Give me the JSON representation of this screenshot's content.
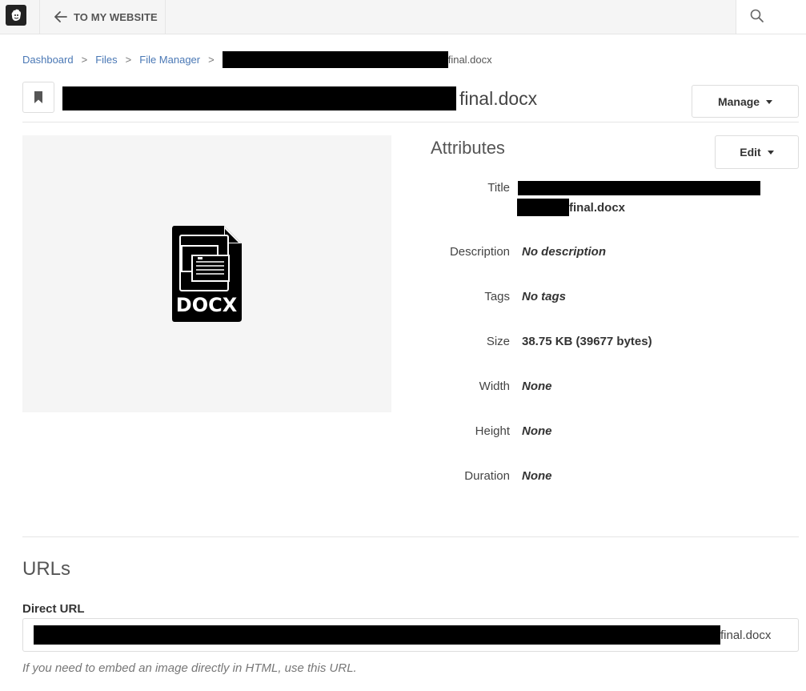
{
  "topbar": {
    "back_label": "TO MY WEBSITE"
  },
  "breadcrumb": {
    "items": [
      "Dashboard",
      "Files",
      "File Manager"
    ],
    "separator": ">",
    "current_suffix": "final.docx"
  },
  "header": {
    "title_suffix": "final.docx",
    "manage_label": "Manage"
  },
  "preview": {
    "file_type_label": "DOCX"
  },
  "attributes": {
    "heading": "Attributes",
    "edit_label": "Edit",
    "title_label": "Title",
    "title_suffix": "final.docx",
    "description_label": "Description",
    "description_value": "No description",
    "tags_label": "Tags",
    "tags_value": "No tags",
    "size_label": "Size",
    "size_value": "38.75 KB (39677 bytes)",
    "width_label": "Width",
    "width_value": "None",
    "height_label": "Height",
    "height_value": "None",
    "duration_label": "Duration",
    "duration_value": "None"
  },
  "urls": {
    "heading": "URLs",
    "direct_label": "Direct URL",
    "direct_suffix": "final.docx",
    "help": "If you need to embed an image directly in HTML, use this URL."
  },
  "colors": {
    "link": "#4a78b5",
    "toolbar_bg": "#f5f5f5",
    "redaction": "#000000"
  },
  "icons": [
    "concrete-logo-icon",
    "arrow-left-icon",
    "search-icon",
    "bookmark-icon",
    "docx-file-icon",
    "caret-down-icon"
  ]
}
